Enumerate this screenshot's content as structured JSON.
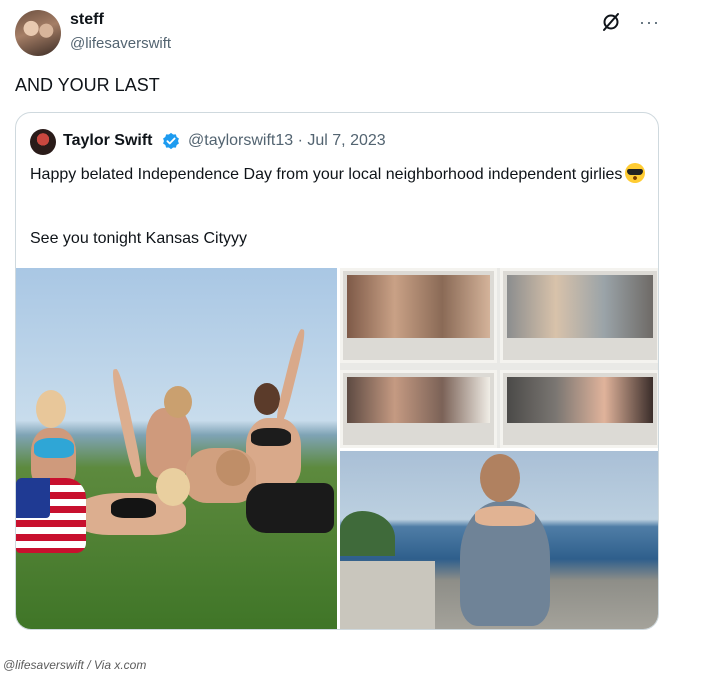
{
  "author": {
    "display_name": "steff",
    "handle": "@lifesaverswift"
  },
  "icons": {
    "grok": "grok-slash-icon",
    "more": "more-horizontal-icon",
    "more_glyph": "···"
  },
  "tweet": {
    "text": "AND YOUR LAST"
  },
  "quoted": {
    "display_name": "Taylor Swift",
    "meta": "@taylorswift13 · Jul 7, 2023",
    "line1": "Happy belated Independence Day from your local neighborhood independent girlies",
    "line2": "See you tonight Kansas Cityyy",
    "emoji": "smiling-face-with-sunglasses",
    "verified_color": "#1d9bf0"
  },
  "media": {
    "photos": [
      "group-on-lawn-photo",
      "polaroid-collage-photo",
      "woman-seated-by-ocean-photo"
    ]
  },
  "caption": "@lifesaverswift / Via x.com"
}
